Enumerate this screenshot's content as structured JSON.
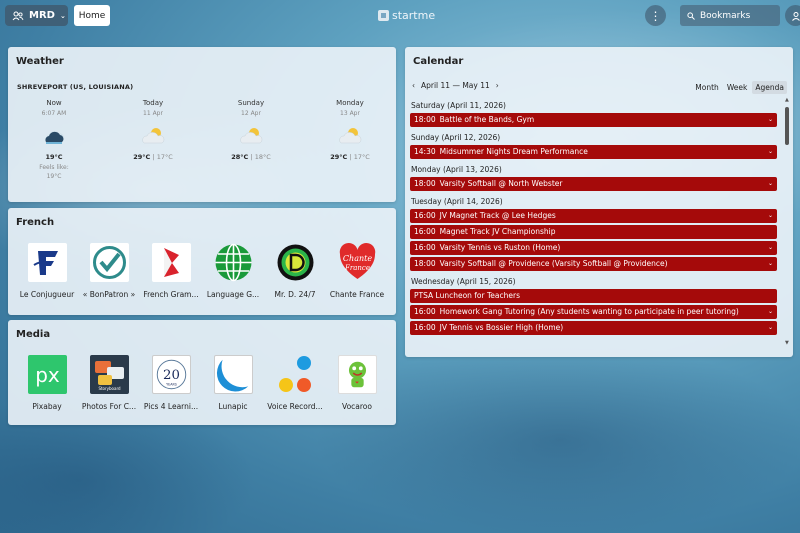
{
  "topbar": {
    "user_label": "MRD",
    "home_tab": "Home",
    "logo_text": "startme",
    "bookmarks_label": "Bookmarks"
  },
  "weather": {
    "title": "Weather",
    "location": "SHREVEPORT (US, LOUISIANA)",
    "columns": [
      {
        "label": "Now",
        "sub": "6:07 AM",
        "icon": "cloud-night-icon",
        "high": "19°C",
        "low": "",
        "feels_label": "Feels like:",
        "feels_value": "19°C"
      },
      {
        "label": "Today",
        "sub": "11 Apr",
        "icon": "partly-cloudy-icon",
        "high": "29°C",
        "low": "17°C"
      },
      {
        "label": "Sunday",
        "sub": "12 Apr",
        "icon": "partly-cloudy-icon",
        "high": "28°C",
        "low": "18°C"
      },
      {
        "label": "Monday",
        "sub": "13 Apr",
        "icon": "partly-cloudy-icon",
        "high": "29°C",
        "low": "17°C"
      }
    ]
  },
  "french": {
    "title": "French",
    "apps": [
      {
        "label": "Le Conjugueur"
      },
      {
        "label": "« BonPatron »"
      },
      {
        "label": "French Gram..."
      },
      {
        "label": "Language G..."
      },
      {
        "label": "Mr. D. 24/7"
      },
      {
        "label": "Chante France"
      }
    ]
  },
  "media": {
    "title": "Media",
    "apps": [
      {
        "label": "Pixabay"
      },
      {
        "label": "Photos For C..."
      },
      {
        "label": "Pics 4 Learni..."
      },
      {
        "label": "Lunapic"
      },
      {
        "label": "Voice Record..."
      },
      {
        "label": "Vocaroo"
      }
    ]
  },
  "calendar": {
    "title": "Calendar",
    "range": "April 11 — May 11",
    "views": [
      "Month",
      "Week",
      "Agenda"
    ],
    "active_view": "Agenda",
    "event_color": "#a50a0a",
    "days": [
      {
        "heading": "Saturday (April 11, 2026)",
        "events": [
          {
            "time": "18:00",
            "title": "Battle of the Bands, Gym",
            "expandable": true
          }
        ]
      },
      {
        "heading": "Sunday (April 12, 2026)",
        "events": [
          {
            "time": "14:30",
            "title": "Midsummer Nights Dream Performance",
            "expandable": true
          }
        ]
      },
      {
        "heading": "Monday (April 13, 2026)",
        "events": [
          {
            "time": "18:00",
            "title": "Varsity Softball @ North Webster",
            "expandable": true
          }
        ]
      },
      {
        "heading": "Tuesday (April 14, 2026)",
        "events": [
          {
            "time": "16:00",
            "title": "JV Magnet Track @ Lee Hedges",
            "expandable": true
          },
          {
            "time": "16:00",
            "title": "Magnet Track JV Championship",
            "expandable": false
          },
          {
            "time": "16:00",
            "title": "Varsity Tennis vs Ruston (Home)",
            "expandable": true
          },
          {
            "time": "18:00",
            "title": "Varsity Softball @ Providence (Varsity Softball @ Providence)",
            "expandable": true
          }
        ]
      },
      {
        "heading": "Wednesday (April 15, 2026)",
        "events": [
          {
            "time": "",
            "title": "PTSA Luncheon for Teachers",
            "expandable": false
          },
          {
            "time": "16:00",
            "title": "Homework Gang Tutoring (Any students wanting to participate in peer tutoring)",
            "expandable": true
          },
          {
            "time": "16:00",
            "title": "JV Tennis vs Bossier High (Home)",
            "expandable": true
          }
        ]
      }
    ]
  }
}
